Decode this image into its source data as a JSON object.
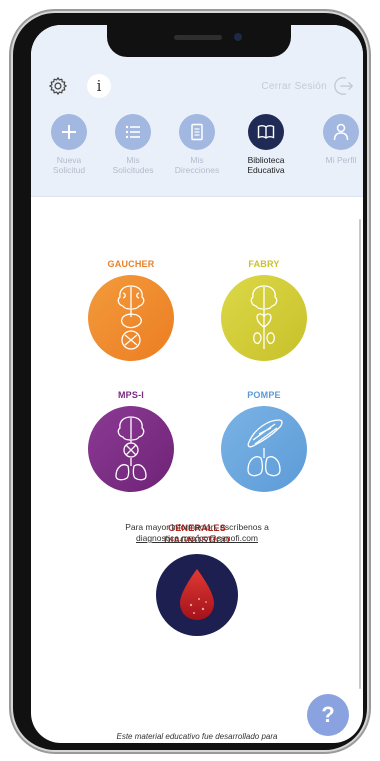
{
  "header": {
    "settings_icon": "gear-icon",
    "info_label": "i",
    "logout_label": "Cerrar Sesión",
    "logout_icon": "logout-arrow-icon"
  },
  "nav": {
    "items": [
      {
        "label_line1": "Nueva",
        "label_line2": "Solicitud",
        "icon": "plus-icon",
        "active": false
      },
      {
        "label_line1": "Mis",
        "label_line2": "Solicitudes",
        "icon": "list-icon",
        "active": false
      },
      {
        "label_line1": "Mis",
        "label_line2": "Direcciones",
        "icon": "document-icon",
        "active": false
      },
      {
        "label_line1": "Biblioteca",
        "label_line2": "Educativa",
        "icon": "book-icon",
        "active": true
      },
      {
        "label_line1": "Mi Perfil",
        "label_line2": "",
        "icon": "user-icon",
        "active": false
      }
    ]
  },
  "library": {
    "gaucher": {
      "title": "GAUCHER",
      "color": "#f08a2a"
    },
    "fabry": {
      "title": "FABRY",
      "color": "#d4cf34"
    },
    "mpsi": {
      "title": "MPS-I",
      "color": "#7a2b82"
    },
    "pompe": {
      "title": "POMPE",
      "color": "#6aa6dc"
    },
    "generales": {
      "title_line1": "GENERALES",
      "title_line2": "DIAGNÓSTICO",
      "color": "#1c1f4f"
    }
  },
  "info": {
    "text": "Para mayor información, escríbenos a",
    "email": "diagnostico.mexico@sanofi.com"
  },
  "footer": {
    "text": "Este material educativo fue desarrollado para"
  },
  "help": {
    "label": "?"
  },
  "colors": {
    "header_bg": "#eaf0fa",
    "nav_inactive": "#a3b8e0",
    "nav_active": "#1f2a55",
    "help_button": "#8aa3e0"
  }
}
